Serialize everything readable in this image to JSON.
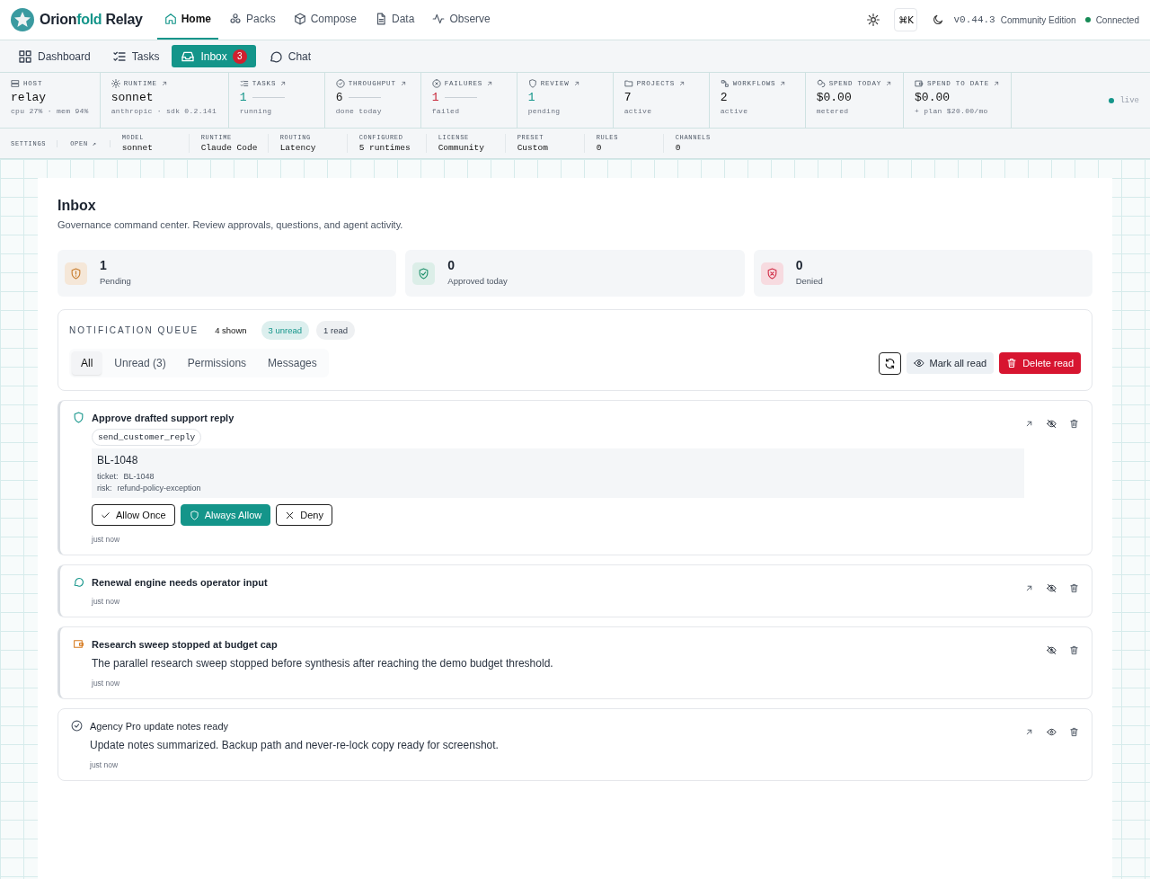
{
  "brand": {
    "first": "Orion",
    "accent": "fold",
    "last": " Relay"
  },
  "nav": [
    {
      "label": "Home",
      "selected": true
    },
    {
      "label": "Packs",
      "selected": false
    },
    {
      "label": "Compose",
      "selected": false
    },
    {
      "label": "Data",
      "selected": false
    },
    {
      "label": "Observe",
      "selected": false
    }
  ],
  "header_right": {
    "shortcut": "⌘K",
    "version": "v0.44.3",
    "edition": "Community Edition",
    "status": "Connected"
  },
  "subnav": [
    {
      "label": "Dashboard",
      "selected": false
    },
    {
      "label": "Tasks",
      "selected": false
    },
    {
      "label": "Inbox",
      "selected": true,
      "badge": "3"
    },
    {
      "label": "Chat",
      "selected": false
    }
  ],
  "metrics": [
    {
      "label": "HOST",
      "link": false,
      "value": "relay",
      "sub": "cpu 27% · mem 94%",
      "bar": false
    },
    {
      "label": "RUNTIME",
      "link": true,
      "value": "sonnet",
      "sub": "anthropic · sdk 0.2.141",
      "bar": false
    },
    {
      "label": "TASKS",
      "link": true,
      "value": "1",
      "sub": "running",
      "bar": true,
      "color": "#14958a"
    },
    {
      "label": "THROUGHPUT",
      "link": true,
      "value": "6",
      "sub": "done today",
      "bar": true,
      "color": "#1a1a1a"
    },
    {
      "label": "FAILURES",
      "link": true,
      "value": "1",
      "sub": "failed",
      "bar": true,
      "color": "#c8283a"
    },
    {
      "label": "REVIEW",
      "link": true,
      "value": "1",
      "sub": "pending",
      "bar": false,
      "color": "#14958a"
    },
    {
      "label": "PROJECTS",
      "link": true,
      "value": "7",
      "sub": "active",
      "bar": false
    },
    {
      "label": "WORKFLOWS",
      "link": true,
      "value": "2",
      "sub": "active",
      "bar": false
    },
    {
      "label": "SPEND TODAY",
      "link": true,
      "value": "$0.00",
      "sub": "metered",
      "bar": false
    },
    {
      "label": "SPEND TO DATE",
      "link": true,
      "value": "$0.00",
      "sub": "+ plan $20.00/mo",
      "bar": false
    }
  ],
  "live": "live",
  "config": {
    "settings": "SETTINGS",
    "open": "OPEN ↗",
    "fields": [
      {
        "label": "MODEL",
        "value": "sonnet"
      },
      {
        "label": "RUNTIME",
        "value": "Claude Code"
      },
      {
        "label": "ROUTING",
        "value": "Latency"
      },
      {
        "label": "CONFIGURED",
        "value": "5 runtimes"
      },
      {
        "label": "LICENSE",
        "value": "Community"
      },
      {
        "label": "PRESET",
        "value": "Custom"
      },
      {
        "label": "RULES",
        "value": "0"
      },
      {
        "label": "CHANNELS",
        "value": "0"
      }
    ]
  },
  "page": {
    "title": "Inbox",
    "subtitle": "Governance command center. Review approvals, questions, and agent activity."
  },
  "summary": [
    {
      "kind": "pending",
      "value": "1",
      "label": "Pending"
    },
    {
      "kind": "approved",
      "value": "0",
      "label": "Approved today"
    },
    {
      "kind": "denied",
      "value": "0",
      "label": "Denied"
    }
  ],
  "queue": {
    "title": "NOTIFICATION QUEUE",
    "shown": "4 shown",
    "unread": "3 unread",
    "read": "1 read",
    "filters": [
      {
        "label": "All",
        "selected": true
      },
      {
        "label": "Unread (3)",
        "selected": false
      },
      {
        "label": "Permissions",
        "selected": false
      },
      {
        "label": "Messages",
        "selected": false
      }
    ],
    "mark_all": "Mark all read",
    "delete_read": "Delete read"
  },
  "notifications": [
    {
      "kind": "permission",
      "unread": true,
      "openable": true,
      "title": "Approve drafted support reply",
      "tool": "send_customer_reply",
      "detail": {
        "heading": "BL-1048",
        "fields": [
          {
            "key": "ticket:",
            "value": "BL-1048"
          },
          {
            "key": "risk:",
            "value": "refund-policy-exception"
          }
        ]
      },
      "actions": [
        {
          "kind": "once",
          "label": "Allow Once"
        },
        {
          "kind": "always",
          "label": "Always Allow"
        },
        {
          "kind": "deny",
          "label": "Deny"
        }
      ],
      "time": "just now"
    },
    {
      "kind": "message",
      "unread": true,
      "openable": true,
      "title": "Renewal engine needs operator input",
      "time": "just now"
    },
    {
      "kind": "budget",
      "unread": true,
      "openable": false,
      "title": "Research sweep stopped at budget cap",
      "body": "The parallel research sweep stopped before synthesis after reaching the demo budget threshold.",
      "time": "just now"
    },
    {
      "kind": "update",
      "unread": false,
      "openable": true,
      "title": "Agency Pro update notes ready",
      "body": "Update notes summarized. Backup path and never-re-lock copy ready for screenshot.",
      "time": "just now"
    }
  ]
}
